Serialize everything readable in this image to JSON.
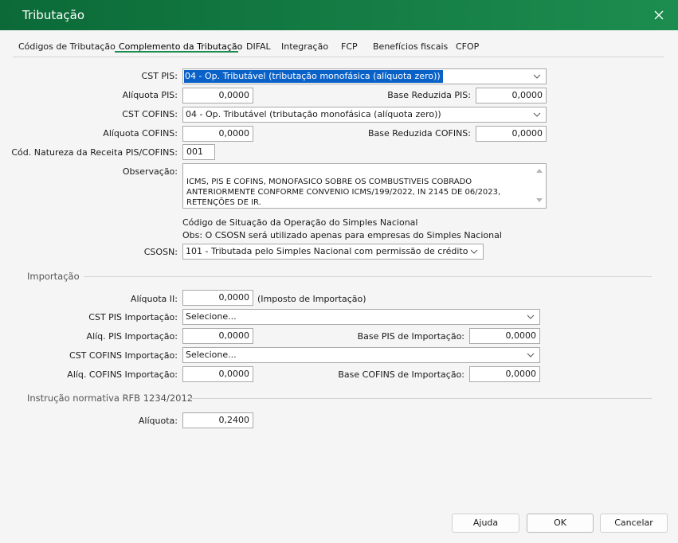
{
  "window": {
    "title": "Tributação"
  },
  "tabs": [
    {
      "label": "Códigos de Tributação"
    },
    {
      "label": "Complemento da Tributação"
    },
    {
      "label": "DIFAL"
    },
    {
      "label": "Integração"
    },
    {
      "label": "FCP"
    },
    {
      "label": "Benefícios fiscais"
    },
    {
      "label": "CFOP"
    }
  ],
  "active_tab": "Complemento da Tributação",
  "pis_cofins": {
    "cst_pis": {
      "label": "CST PIS:",
      "value": "04 - Op. Tributável (tributação monofásica (alíquota zero))"
    },
    "aliquota_pis": {
      "label": "Alíquota PIS:",
      "value": "0,0000"
    },
    "base_reduzida_pis": {
      "label": "Base Reduzida PIS:",
      "value": "0,0000"
    },
    "cst_cofins": {
      "label": "CST COFINS:",
      "value": "04 - Op. Tributável (tributação monofásica (alíquota zero))"
    },
    "aliquota_cofins": {
      "label": "Alíquota COFINS:",
      "value": "0,0000"
    },
    "base_reduzida_cofins": {
      "label": "Base Reduzida COFINS:",
      "value": "0,0000"
    },
    "natureza_receita": {
      "label": "Cód. Natureza da Receita PIS/COFINS:",
      "value": "001"
    },
    "observacao": {
      "label": "Observação:",
      "value": "ICMS, PIS E COFINS, MONOFASICO SOBRE OS COMBUSTIVEIS COBRADO\nANTERIORMENTE CONFORME CONVENIO ICMS/199/2022, IN 2145 DE 06/2023,\nRETENÇÕES DE IR."
    }
  },
  "simples": {
    "heading": "Código de Situação da Operação do Simples Nacional",
    "note": "Obs: O CSOSN será utilizado apenas para empresas do Simples Nacional",
    "csosn": {
      "label": "CSOSN:",
      "value": "101 - Tributada pelo Simples Nacional com permissão de crédito"
    }
  },
  "importacao": {
    "title": "Importação",
    "aliquota_ii": {
      "label": "Alíquota II:",
      "value": "0,0000",
      "suffix": "(Imposto de Importação)"
    },
    "cst_pis_importacao": {
      "label": "CST PIS Importação:",
      "value": "Selecione..."
    },
    "aliq_pis_importacao": {
      "label": "Alíq. PIS Importação:",
      "value": "0,0000"
    },
    "base_pis_importacao": {
      "label": "Base PIS de Importação:",
      "value": "0,0000"
    },
    "cst_cofins_importacao": {
      "label": "CST COFINS Importação:",
      "value": "Selecione..."
    },
    "aliq_cofins_importacao": {
      "label": "Alíq. COFINS Importação:",
      "value": "0,0000"
    },
    "base_cofins_importacao": {
      "label": "Base COFINS de Importação:",
      "value": "0,0000"
    }
  },
  "rfb": {
    "title": "Instrução normativa RFB 1234/2012",
    "aliquota": {
      "label": "Alíquota:",
      "value": "0,2400"
    }
  },
  "buttons": {
    "help": "Ajuda",
    "ok": "OK",
    "cancel": "Cancelar"
  },
  "colors": {
    "titlebar_start": "#0b6a38",
    "titlebar_end": "#1d8d4f",
    "selection": "#0a62c8",
    "tab_accent": "#1d8d4f"
  },
  "icons": {
    "close": "close-icon",
    "dropdown": "chevron-down-icon"
  }
}
